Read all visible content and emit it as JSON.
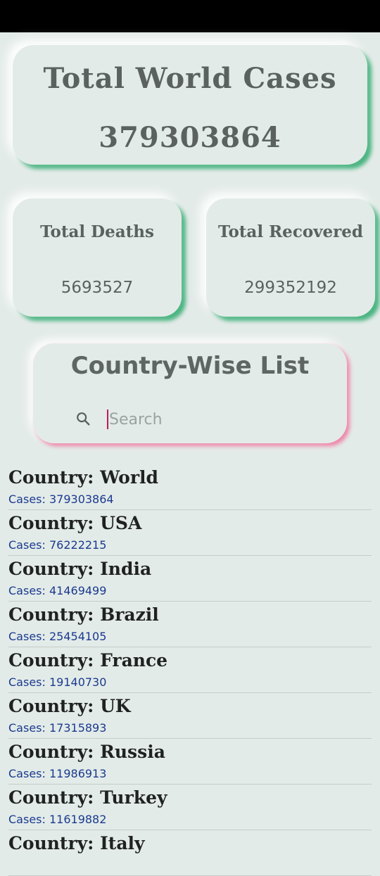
{
  "summary": {
    "total_title": "Total World Cases",
    "total_value": "379303864",
    "deaths_label": "Total Deaths",
    "deaths_value": "5693527",
    "recovered_label": "Total Recovered",
    "recovered_value": "299352192"
  },
  "search": {
    "title": "Country-Wise List",
    "placeholder": "Search",
    "icon": "search-icon"
  },
  "countries": [
    {
      "country": "Country: World",
      "cases": "Cases:  379303864"
    },
    {
      "country": "Country: USA",
      "cases": "Cases:  76222215"
    },
    {
      "country": "Country: India",
      "cases": "Cases:  41469499"
    },
    {
      "country": "Country: Brazil",
      "cases": "Cases:  25454105"
    },
    {
      "country": "Country: France",
      "cases": "Cases:  19140730"
    },
    {
      "country": "Country: UK",
      "cases": "Cases:  17315893"
    },
    {
      "country": "Country: Russia",
      "cases": "Cases:  11986913"
    },
    {
      "country": "Country: Turkey",
      "cases": "Cases:  11619882"
    },
    {
      "country": "Country: Italy",
      "cases": ""
    }
  ],
  "colors": {
    "background": "#e3ebe8",
    "accent_green": "#2eaa6e",
    "accent_pink": "#f078a0",
    "cases_text": "#1a3a8f",
    "caret": "#c2185b"
  }
}
